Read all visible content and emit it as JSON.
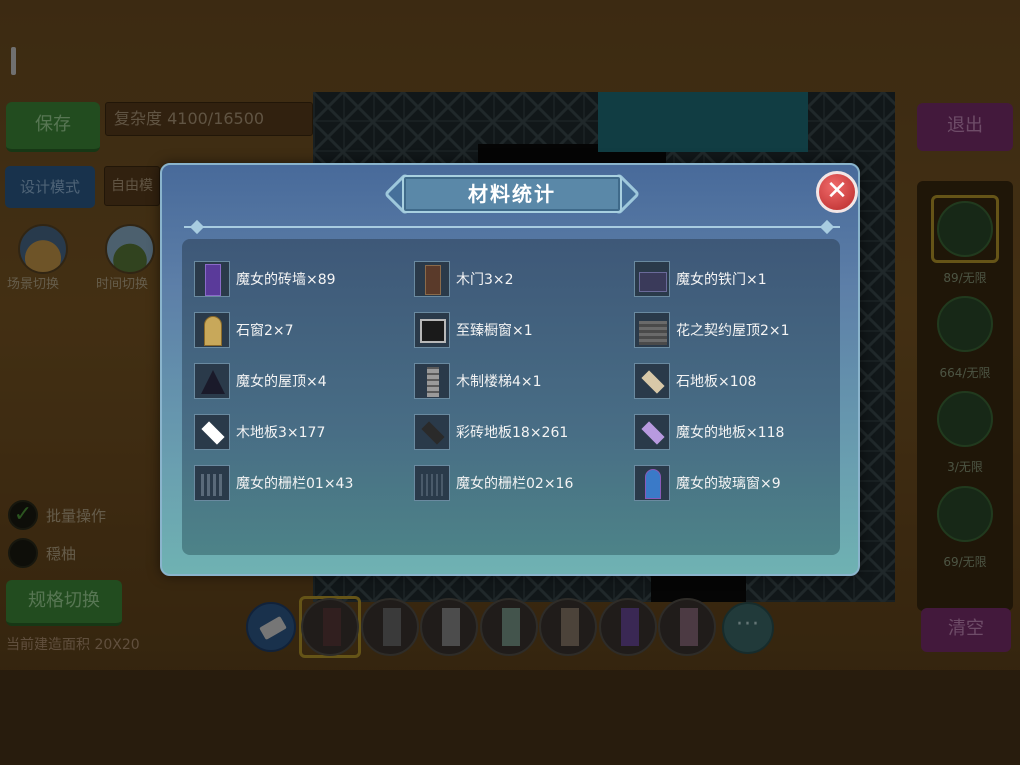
{
  "background": {
    "save_label": "保存",
    "complexity_label": "复杂度 4100/16500",
    "exit_label": "退出",
    "design_mode_label": "设计模式",
    "free_mode_label": "自由模",
    "scene_switch_label": "场景切换",
    "time_switch_label": "时间切换",
    "batch_op_label": "批量操作",
    "hidden_label": "穏柚",
    "spec_switch_label": "规格切换",
    "build_area_label": "当前建造面积 20X20",
    "clear_label": "清空",
    "right_panel_counts": [
      "89/无限",
      "664/无限",
      "3/无限",
      "69/无限"
    ],
    "more_label": "···"
  },
  "modal": {
    "title": "材料统计",
    "close_icon": "close-icon",
    "items": [
      {
        "name": "魔女的砖墙×89",
        "icon": "witch-brick-wall-icon"
      },
      {
        "name": "木门3×2",
        "icon": "wooden-door-icon"
      },
      {
        "name": "魔女的铁门×1",
        "icon": "witch-iron-gate-icon"
      },
      {
        "name": "石窗2×7",
        "icon": "stone-window-icon"
      },
      {
        "name": "至臻橱窗×1",
        "icon": "showcase-window-icon"
      },
      {
        "name": "花之契约屋顶2×1",
        "icon": "flower-pact-roof-icon"
      },
      {
        "name": "魔女的屋顶×4",
        "icon": "witch-roof-icon"
      },
      {
        "name": "木制楼梯4×1",
        "icon": "wooden-stairs-icon"
      },
      {
        "name": "石地板×108",
        "icon": "stone-floor-icon"
      },
      {
        "name": "木地板3×177",
        "icon": "wooden-floor-icon"
      },
      {
        "name": "彩砖地板18×261",
        "icon": "colored-tile-floor-icon"
      },
      {
        "name": "魔女的地板×118",
        "icon": "witch-floor-icon"
      },
      {
        "name": "魔女的栅栏01×43",
        "icon": "witch-fence-01-icon"
      },
      {
        "name": "魔女的栅栏02×16",
        "icon": "witch-fence-02-icon"
      },
      {
        "name": "魔女的玻璃窗×9",
        "icon": "witch-glass-window-icon"
      }
    ]
  }
}
